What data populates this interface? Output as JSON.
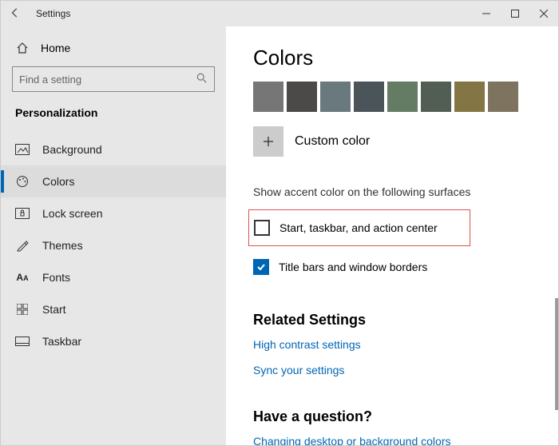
{
  "window": {
    "title": "Settings"
  },
  "sidebar": {
    "home": "Home",
    "search_placeholder": "Find a setting",
    "category": "Personalization",
    "items": [
      {
        "label": "Background"
      },
      {
        "label": "Colors"
      },
      {
        "label": "Lock screen"
      },
      {
        "label": "Themes"
      },
      {
        "label": "Fonts"
      },
      {
        "label": "Start"
      },
      {
        "label": "Taskbar"
      }
    ]
  },
  "main": {
    "heading": "Colors",
    "swatches": [
      "#767676",
      "#4c4a48",
      "#69797e",
      "#4a5459",
      "#647c64",
      "#525e54",
      "#847545",
      "#7e735f"
    ],
    "custom_label": "Custom color",
    "accent_section": "Show accent color on the following surfaces",
    "chk_start": "Start, taskbar, and action center",
    "chk_title": "Title bars and window borders",
    "related_heading": "Related Settings",
    "link_contrast": "High contrast settings",
    "link_sync": "Sync your settings",
    "question_heading": "Have a question?",
    "link_help": "Changing desktop or background colors"
  }
}
